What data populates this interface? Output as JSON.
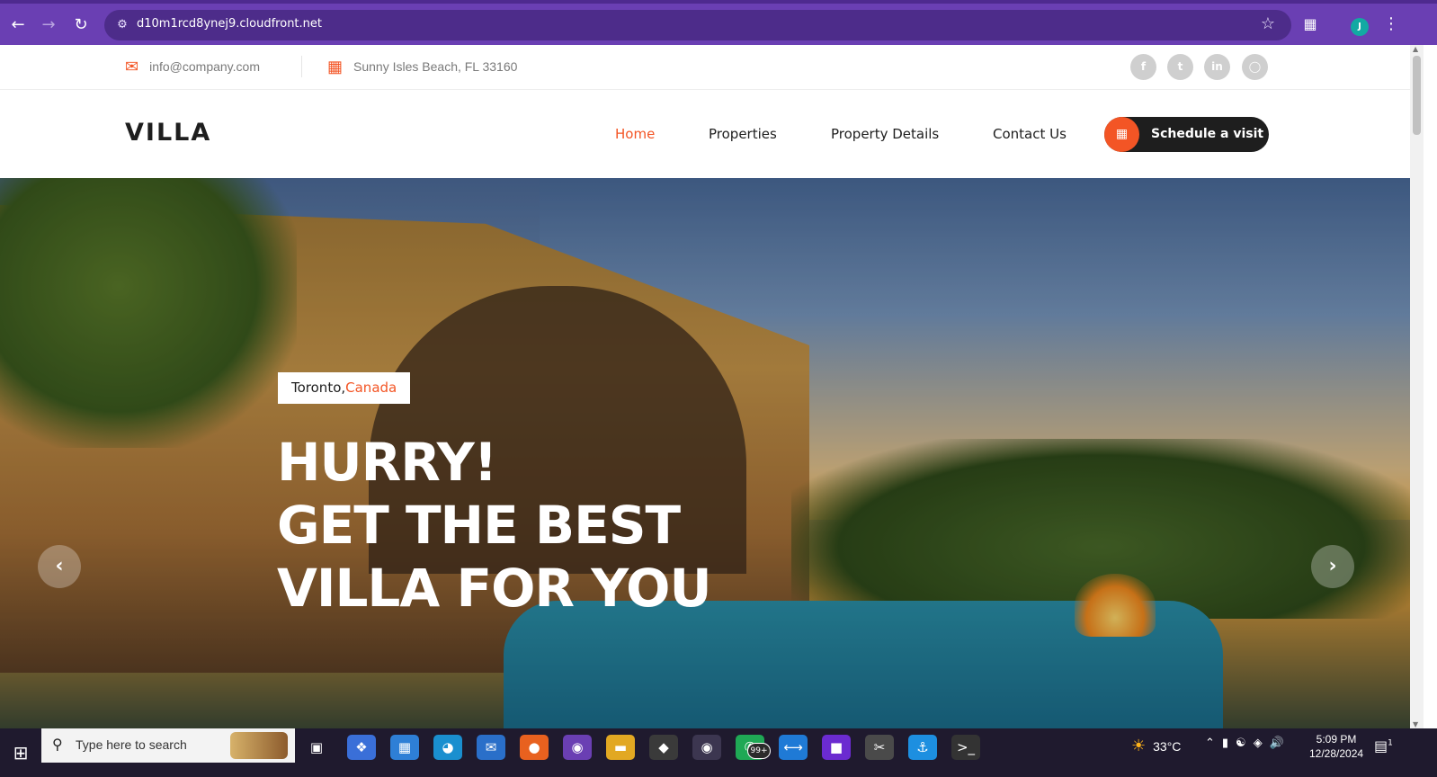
{
  "browser": {
    "url": "d10m1rcd8ynej9.cloudfront.net",
    "profile_initial": "J"
  },
  "info_bar": {
    "email": "info@company.com",
    "address": "Sunny Isles Beach, FL 33160",
    "socials": [
      "facebook-icon",
      "twitter-icon",
      "linkedin-icon",
      "instagram-icon"
    ]
  },
  "header": {
    "logo": "VILLA",
    "nav": [
      {
        "label": "Home",
        "active": true
      },
      {
        "label": "Properties",
        "active": false
      },
      {
        "label": "Property Details",
        "active": false
      },
      {
        "label": "Contact Us",
        "active": false
      }
    ],
    "cta_label": "Schedule a visit"
  },
  "hero": {
    "city": "Toronto, ",
    "country": "Canada",
    "line1": "HURRY!",
    "line2": "GET THE BEST",
    "line3": "VILLA FOR YOU"
  },
  "taskbar": {
    "search_placeholder": "Type here to search",
    "whatsapp_badge": "99+",
    "temperature": "33°C",
    "time": "5:09 PM",
    "date": "12/28/2024",
    "notification_count": "1"
  },
  "colors": {
    "accent": "#f35525",
    "dark": "#1e1e1e",
    "browser": "#6a3fb3"
  }
}
